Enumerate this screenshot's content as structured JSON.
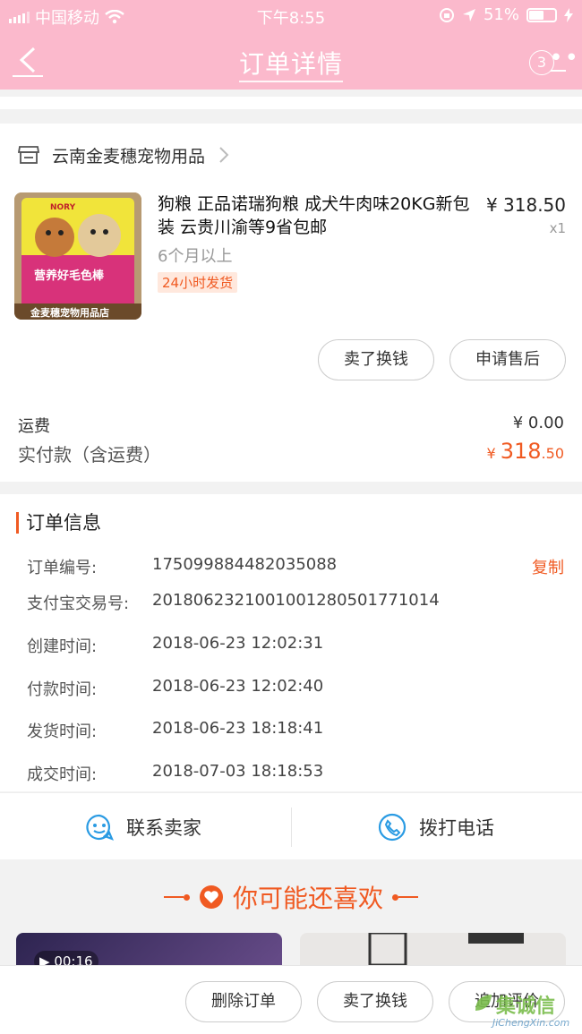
{
  "status_bar": {
    "carrier": "中国移动",
    "time": "下午8:55",
    "battery": "51%"
  },
  "nav": {
    "title": "订单详情",
    "badge_count": "3"
  },
  "shop": {
    "name": "云南金麦穗宠物用品"
  },
  "product": {
    "title": "狗粮 正品诺瑞狗粮 成犬牛肉味20KG新包装 云贵川渝等9省包邮",
    "price": "¥ 318.50",
    "qty": "x1",
    "spec": "6个月以上",
    "tag": "24小时发货",
    "bag_brand": "NORY",
    "bag_label": "营养好毛色棒",
    "bag_shop": "金麦穗宠物用品店"
  },
  "actions": {
    "sell_exchange": "卖了换钱",
    "after_sale": "申请售后"
  },
  "fees": {
    "shipping_label": "运费",
    "shipping_value": "¥ 0.00",
    "paid_label": "实付款（含运费）",
    "paid_currency": "¥",
    "paid_int": "318",
    "paid_dec": ".50"
  },
  "order_info": {
    "title": "订单信息",
    "copy_label": "复制",
    "rows": [
      {
        "label": "订单编号:",
        "value": "175099884482035088"
      },
      {
        "label": "支付宝交易号:",
        "value": "2018062321001001280501771014"
      },
      {
        "label": "创建时间:",
        "value": "2018-06-23 12:02:31"
      },
      {
        "label": "付款时间:",
        "value": "2018-06-23 12:02:40"
      },
      {
        "label": "发货时间:",
        "value": "2018-06-23 18:18:41"
      },
      {
        "label": "成交时间:",
        "value": "2018-07-03 18:18:53"
      }
    ]
  },
  "contact": {
    "seller": "联系卖家",
    "call": "拨打电话"
  },
  "recommend": {
    "title": "你可能还喜欢",
    "video_duration": "00:16"
  },
  "bottom": {
    "delete": "删除订单",
    "sell": "卖了换钱",
    "review": "追加评价"
  },
  "watermark": {
    "cn": "集诚信",
    "en": "JiChengXin.com"
  },
  "colors": {
    "header": "#fbb9cc",
    "accent": "#f05a22"
  }
}
